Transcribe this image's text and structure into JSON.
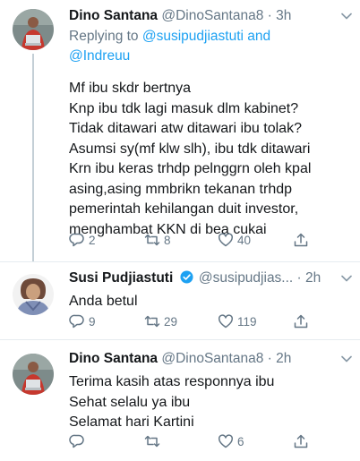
{
  "tweets": [
    {
      "name": "Dino Santana",
      "handle": "@DinoSantana8",
      "time": "3h",
      "replying_prefix": "Replying to ",
      "replying_to_1": "@susipudjiastuti",
      "replying_and": " and",
      "replying_to_2": "@Indreuu",
      "text": "Mf ibu skdr bertnya\nKnp ibu tdk lagi masuk dlm kabinet?\nTidak ditawari atw ditawari ibu tolak?\nAsumsi sy(mf klw slh), ibu tdk ditawari\nKrn ibu keras trhdp pelnggrn oleh kpal\nasing,asing mmbrikn tekanan trhdp\npemerintah kehilangan duit investor,\nmenghambat KKN di bea cukai",
      "replies": "2",
      "retweets": "8",
      "likes": "40"
    },
    {
      "name": "Susi Pudjiastuti",
      "handle": "@susipudjias...",
      "time": "2h",
      "text": "Anda betul",
      "replies": "9",
      "retweets": "29",
      "likes": "119"
    },
    {
      "name": "Dino Santana",
      "handle": "@DinoSantana8",
      "time": "2h",
      "text": "Terima kasih atas responnya ibu\nSehat selalu ya ibu\nSelamat hari Kartini",
      "replies": "",
      "retweets": "",
      "likes": "6"
    }
  ],
  "separator": " · ",
  "icons": {
    "reply": "reply-icon",
    "retweet": "retweet-icon",
    "like": "like-icon",
    "share": "share-icon",
    "more": "chevron-down-icon",
    "verified": "verified-badge-icon"
  },
  "colors": {
    "link": "#1da1f2",
    "muted": "#657786",
    "verified": "#1da1f2"
  }
}
